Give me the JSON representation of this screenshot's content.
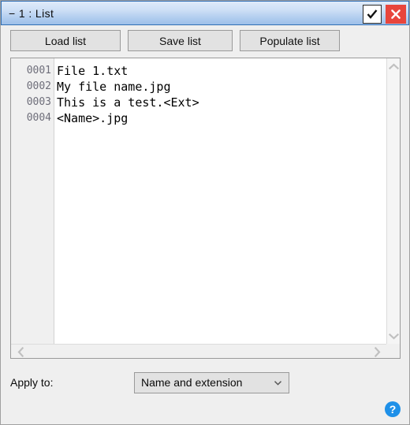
{
  "window": {
    "title": "− 1 : List",
    "accent_blue": "#2f6fb5",
    "close_red": "#e8453c",
    "help_blue": "#1e90e8"
  },
  "titlebar": {
    "confirm_icon": "checkmark-icon",
    "close_icon": "close-x-icon"
  },
  "toolbar": {
    "load_label": "Load list",
    "save_label": "Save list",
    "populate_label": "Populate list"
  },
  "editor": {
    "line_numbers": [
      "0001",
      "0002",
      "0003",
      "0004"
    ],
    "lines": [
      "File 1.txt",
      "My file name.jpg",
      "This is a test.<Ext>",
      "<Name>.jpg"
    ],
    "scroll_up_icon": "chevron-up-icon",
    "scroll_down_icon": "chevron-down-icon",
    "scroll_left_icon": "chevron-left-icon",
    "scroll_right_icon": "chevron-right-icon"
  },
  "bottom": {
    "apply_label": "Apply to:",
    "apply_value": "Name and extension",
    "dropdown_icon": "chevron-down-icon",
    "help_label": "?"
  }
}
